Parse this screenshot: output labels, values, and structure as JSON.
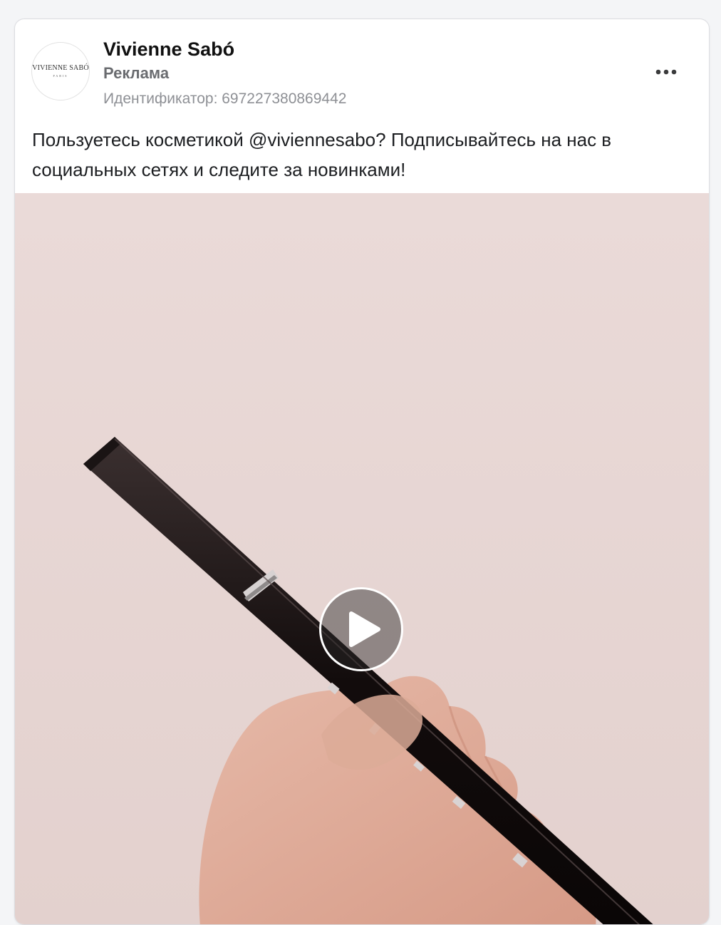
{
  "post": {
    "page_name": "Vivienne Sabó",
    "sponsored_label": "Реклама",
    "ad_id_text": "Идентификатор: 697227380869442",
    "avatar": {
      "logo_text": "VIVIENNE SABÓ",
      "logo_subtext": "PARIS"
    },
    "menu_icon": "more-horizontal-icon",
    "text": "Пользуетесь косметикой @viviennesabo? Подписывайтесь на нас в социальных сетях и следите за новинками!",
    "media": {
      "type": "video",
      "play_icon": "play-icon",
      "background_color": "#ead9d7"
    }
  }
}
